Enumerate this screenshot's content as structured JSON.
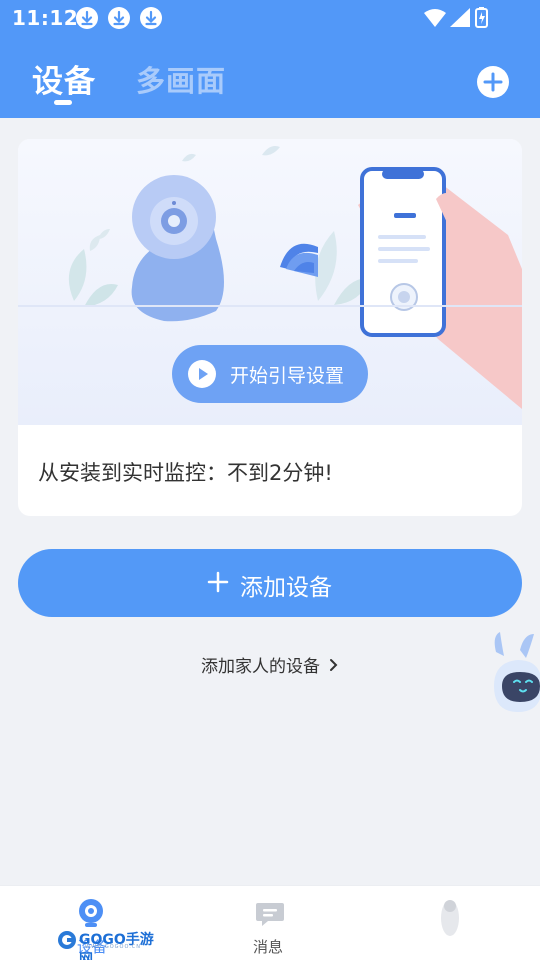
{
  "status_bar": {
    "time": "11:12",
    "icons": [
      "download-icon",
      "download-icon",
      "download-icon",
      "wifi-icon",
      "signal-icon",
      "battery-icon"
    ]
  },
  "header": {
    "tabs": [
      {
        "label": "设备",
        "active": true
      },
      {
        "label": "多画面",
        "active": false
      }
    ],
    "add_icon": "plus-circle-icon",
    "background_color": "#5298f8"
  },
  "guide_card": {
    "button_label": "开始引导设置",
    "caption": "从安装到实时监控：不到2分钟!"
  },
  "primary_action": {
    "label": "添加设备",
    "color": "#5399f7"
  },
  "family_link": {
    "label": "添加家人的设备"
  },
  "bottom_nav": {
    "items": [
      {
        "label": "设备",
        "icon": "camera-icon",
        "active": true
      },
      {
        "label": "消息",
        "icon": "message-icon",
        "active": false
      },
      {
        "label": "",
        "icon": "profile-icon",
        "active": false
      }
    ]
  },
  "watermark": {
    "text": "GOGO手游网",
    "subtext": "WWW.GOGOO.CN"
  }
}
